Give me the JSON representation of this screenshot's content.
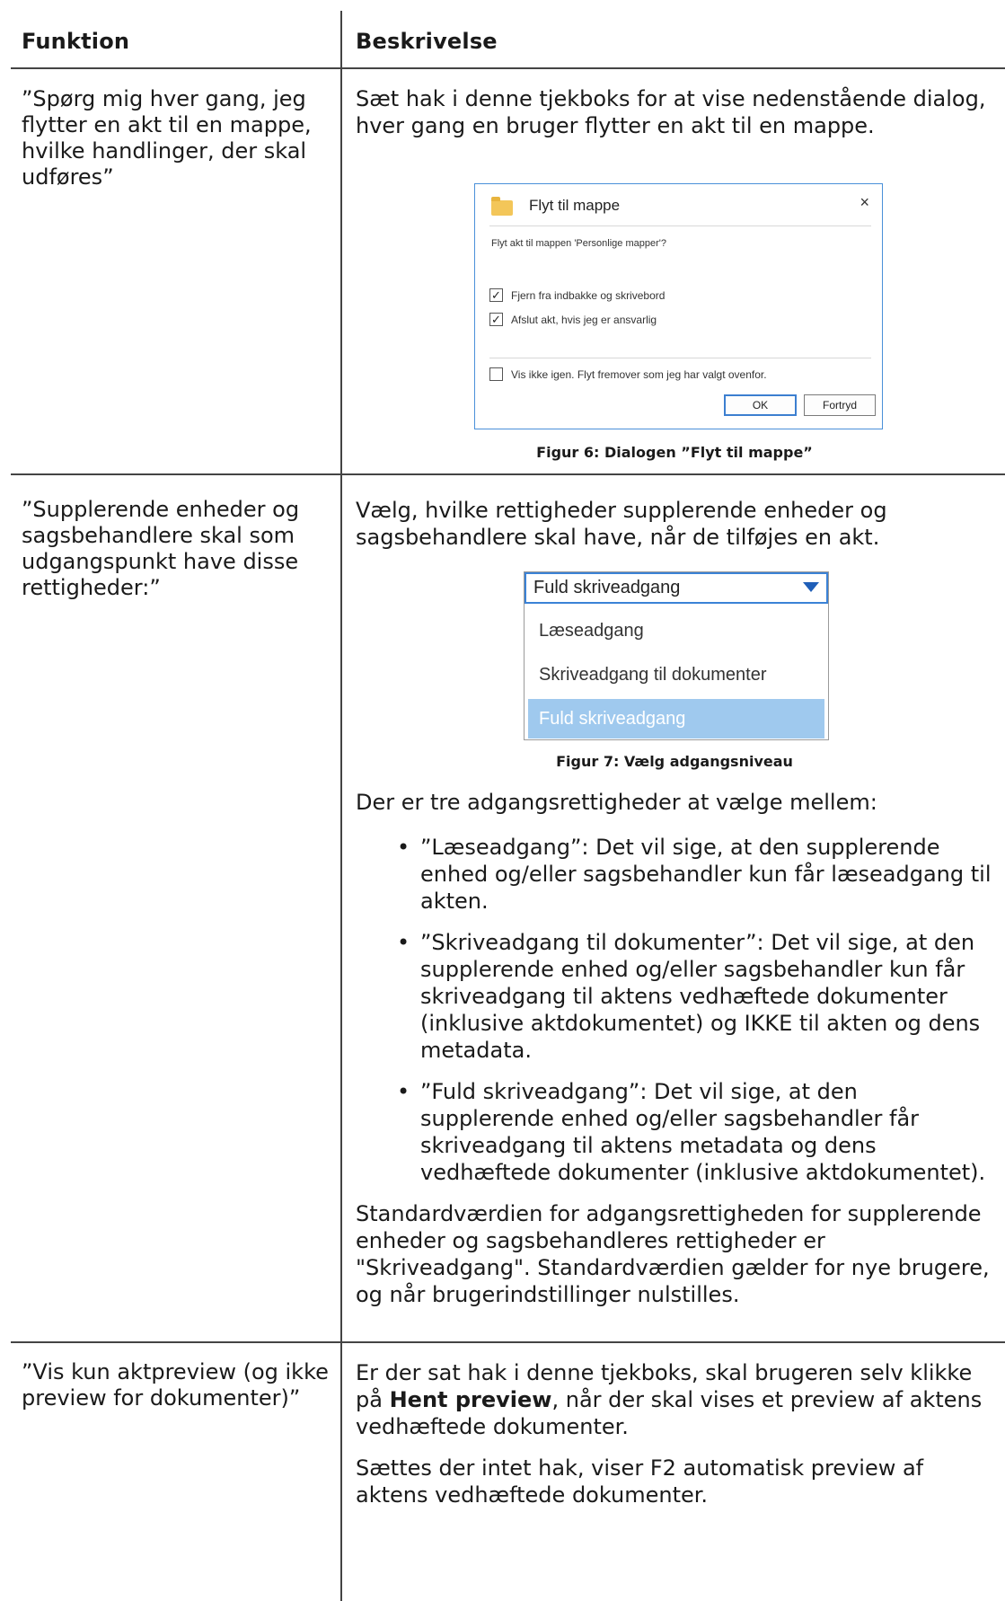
{
  "header": {
    "col1": "Funktion",
    "col2": "Beskrivelse"
  },
  "row1": {
    "function": "”Spørg mig hver gang, jeg flytter en akt til en mappe, hvilke handlinger, der skal udføres”",
    "description": "Sæt hak i denne tjekboks for at vise nedenstående dialog, hver gang en bruger flytter en akt til en mappe.",
    "dialog": {
      "title": "Flyt til mappe",
      "close": "×",
      "question": "Flyt akt til mappen 'Personlige mapper'?",
      "opt1": "Fjern fra indbakke og skrivebord",
      "opt1_checked": true,
      "opt2": "Afslut akt, hvis jeg er ansvarlig",
      "opt2_checked": true,
      "opt3": "Vis ikke igen. Flyt fremover som jeg har valgt ovenfor.",
      "opt3_checked": false,
      "ok": "OK",
      "cancel": "Fortryd",
      "check_mark": "✓"
    },
    "caption": "Figur 6: Dialogen ”Flyt til mappe”"
  },
  "row2": {
    "function": "”Supplerende enheder og sagsbehandlere skal som udgangspunkt have disse rettigheder:”",
    "description": "Vælg, hvilke rettigheder supplerende enheder og sagsbehandlere skal have, når de tilføjes en akt.",
    "dropdown": {
      "selected": "Fuld skriveadgang",
      "options": [
        "Læseadgang",
        "Skriveadgang til dokumenter",
        "Fuld skriveadgang"
      ]
    },
    "caption": "Figur 7: Vælg adgangsniveau",
    "intro": "Der er tre adgangsrettigheder at vælge mellem:",
    "bullets": [
      "”Læseadgang”: Det vil sige, at den supplerende enhed og/eller sagsbehandler kun får læseadgang til akten.",
      "”Skriveadgang til dokumenter”: Det vil sige, at den supplerende enhed og/eller sagsbehandler kun får skriveadgang til aktens vedhæftede dokumenter (inklusive aktdokumentet) og IKKE til akten og dens metadata.",
      "”Fuld skriveadgang”: Det vil sige, at den supplerende enhed og/eller sagsbehandler får skriveadgang til aktens metadata og dens vedhæftede dokumenter (inklusive aktdokumentet)."
    ],
    "standard": "Standardværdien for adgangsrettigheden for supplerende enheder og sagsbehandleres rettigheder er \"Skriveadgang\". Standardværdien gælder for nye brugere, og når brugerindstillinger nulstilles."
  },
  "row3": {
    "function": "”Vis kun aktpreview (og ikke preview for dokumenter)”",
    "desc_before": "Er der sat hak i denne tjekboks, skal brugeren selv klikke på ",
    "desc_bold": "Hent preview",
    "desc_after": ", når der skal vises et preview af aktens vedhæftede dokumenter.",
    "desc2": "Sættes der intet hak, viser F2 automatisk preview af aktens vedhæftede dokumenter."
  }
}
